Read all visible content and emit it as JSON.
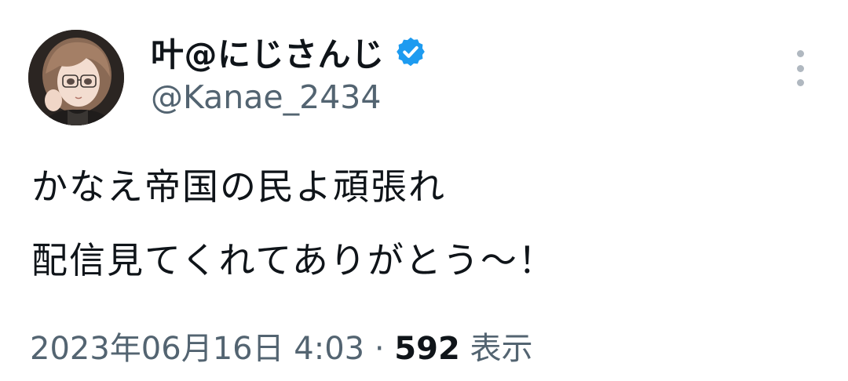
{
  "author": {
    "display_name": "叶@にじさんじ",
    "handle": "@Kanae_2434",
    "verified_badge_color": "#1d9bf0"
  },
  "tweet": {
    "lines": [
      "かなえ帝国の民よ頑張れ",
      "配信見てくれてありがとう～！"
    ]
  },
  "meta": {
    "timestamp": "2023年06月16日 4:03",
    "separator": " · ",
    "views_count": "592",
    "views_label": "表示"
  },
  "icons": {
    "verified": "verified-badge-icon",
    "more": "more-options-icon"
  }
}
